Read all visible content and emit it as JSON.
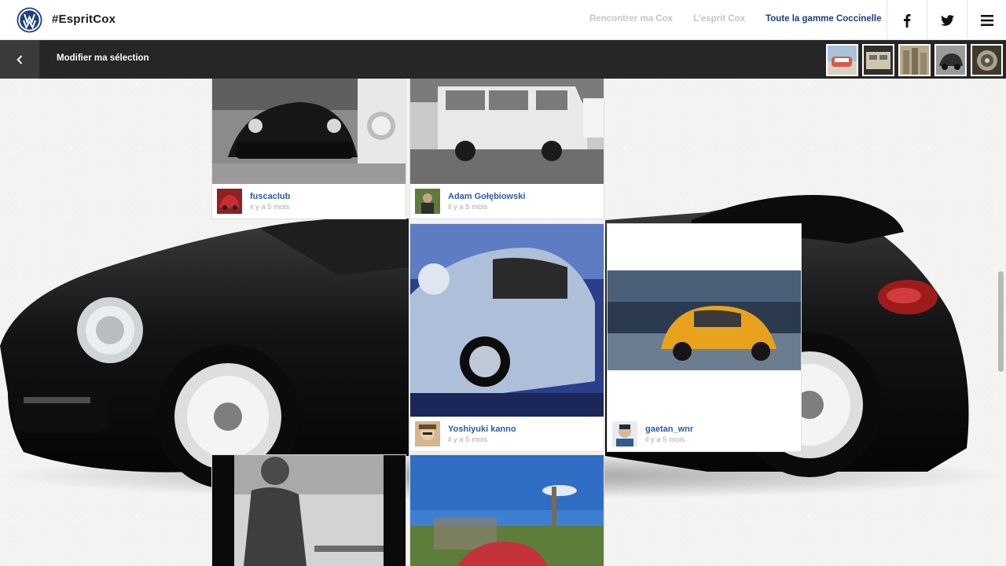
{
  "header": {
    "brand": "#EspritCox",
    "nav": [
      {
        "label": "Rencontrer ma Cox",
        "active": false
      },
      {
        "label": "L'esprit Cox",
        "active": false
      },
      {
        "label": "Toute la gamme Coccinelle",
        "active": true
      }
    ],
    "social": [
      {
        "icon": "facebook-icon"
      },
      {
        "icon": "twitter-icon"
      },
      {
        "icon": "menu-icon"
      }
    ]
  },
  "subbar": {
    "back_icon": "chevron-left-icon",
    "title": "Modifier ma sélection",
    "thumbnails": [
      {
        "name": "thumb-1",
        "colors": [
          "#a8c3d9",
          "#d65a4b"
        ]
      },
      {
        "name": "thumb-2",
        "colors": [
          "#cfc6b0",
          "#3b3b3b"
        ]
      },
      {
        "name": "thumb-3",
        "colors": [
          "#b9a98d",
          "#6f6555"
        ]
      },
      {
        "name": "thumb-4",
        "colors": [
          "#8d8d8d",
          "#2f2f2f"
        ]
      },
      {
        "name": "thumb-5",
        "colors": [
          "#403a2a",
          "#a8a090"
        ]
      }
    ]
  },
  "posts": [
    {
      "user": "fuscaclub",
      "time": "il y a 5 mois"
    },
    {
      "user": "Adam Gołębiowski",
      "time": "il y a 5 mois"
    },
    {
      "user": "Yoshiyuki kanno",
      "time": "il y a 5 mois"
    },
    {
      "user": "gaetan_wnr",
      "time": "il y a 5 mois"
    }
  ],
  "colors": {
    "accent": "#1e3e7d",
    "username": "#2a5ba8",
    "bar": "#262626",
    "inactive_nav": "#c5c5c5"
  }
}
